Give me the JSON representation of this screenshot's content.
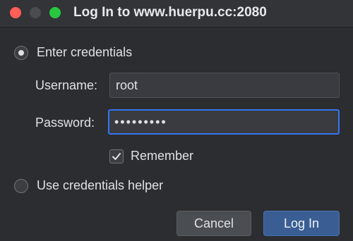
{
  "window": {
    "title": "Log In to www.huerpu.cc:2080"
  },
  "options": {
    "credentials_label": "Enter credentials",
    "credentials_selected": true,
    "helper_label": "Use credentials helper",
    "helper_selected": false
  },
  "form": {
    "username_label": "Username:",
    "username_value": "root",
    "password_label": "Password:",
    "password_masked": "•••••••••",
    "remember_label": "Remember",
    "remember_checked": true
  },
  "buttons": {
    "cancel_label": "Cancel",
    "login_label": "Log In"
  },
  "colors": {
    "accent": "#3574f0",
    "primary_button": "#3a5e93",
    "close": "#ff5f57",
    "maximize": "#28c840"
  },
  "icons": {
    "radio_selected": "radio-dot-icon",
    "checkbox_checked": "checkmark-icon"
  }
}
